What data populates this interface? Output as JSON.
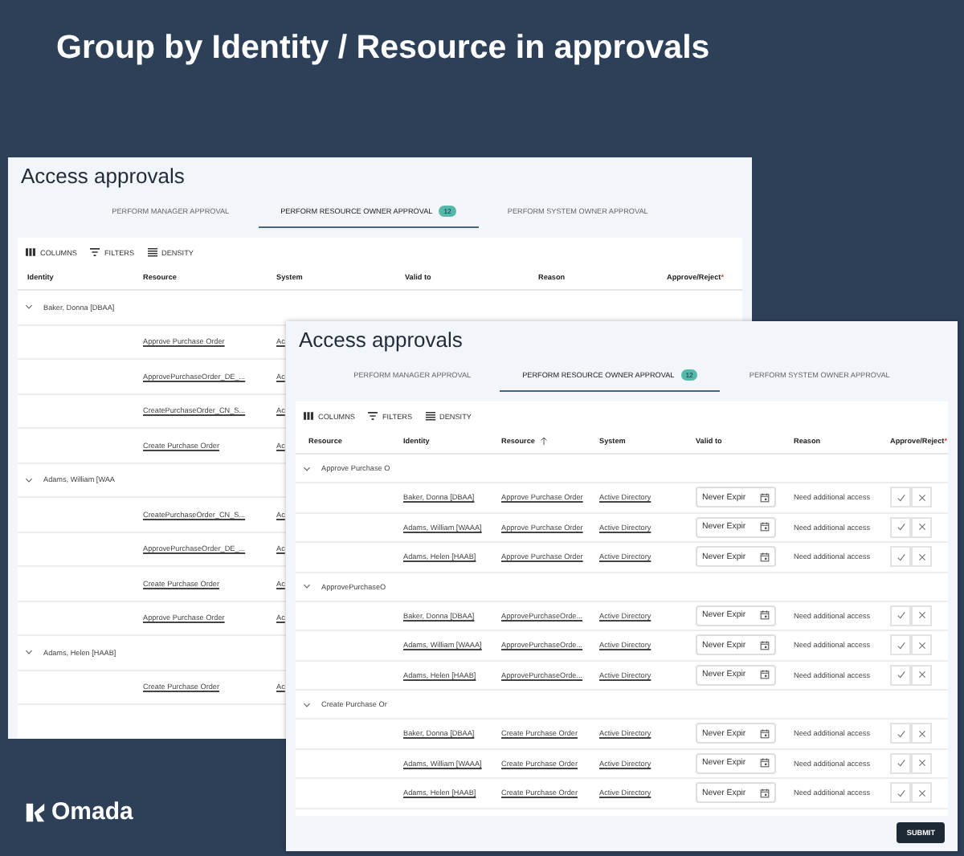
{
  "slide_title": "Group by Identity / Resource in approvals",
  "back_window": {
    "title": "Access approvals",
    "tabs": [
      {
        "label": "PERFORM MANAGER APPROVAL",
        "selected": false
      },
      {
        "label": "PERFORM RESOURCE OWNER APPROVAL",
        "selected": true,
        "badge": "12"
      },
      {
        "label": "PERFORM SYSTEM OWNER APPROVAL",
        "selected": false
      }
    ],
    "toolbar": [
      {
        "kind": "columns",
        "label": "COLUMNS"
      },
      {
        "kind": "filters",
        "label": "FILTERS"
      },
      {
        "kind": "density",
        "label": "DENSITY"
      }
    ],
    "columns": [
      {
        "label": "Identity"
      },
      {
        "label": "Resource"
      },
      {
        "label": "System"
      },
      {
        "label": "Valid to"
      },
      {
        "label": "Reason"
      },
      {
        "label": "Approve/Reject",
        "marker": "*"
      }
    ],
    "groups": [
      {
        "label": "Baker, Donna [DBAA]",
        "expanded": true,
        "rows": [
          {
            "resource": "Approve Purchase Order",
            "system": "Ac"
          },
          {
            "resource": "ApprovePurchaseOrder_DE_...",
            "system": "Ac"
          },
          {
            "resource": "CreatePurchaseOrder_CN_S...",
            "system": "Ac"
          },
          {
            "resource": "Create Purchase Order",
            "system": "Ac"
          }
        ]
      },
      {
        "label": "Adams, William [WAA",
        "expanded": true,
        "rows": [
          {
            "resource": "CreatePurchaseOrder_CN_S...",
            "system": "Ac"
          },
          {
            "resource": "ApprovePurchaseOrder_DE_...",
            "system": "Ac"
          },
          {
            "resource": "Create Purchase Order",
            "system": "Ac"
          },
          {
            "resource": "Approve Purchase Order",
            "system": "Ac"
          }
        ]
      },
      {
        "label": "Adams, Helen [HAAB]",
        "expanded": true,
        "rows": [
          {
            "resource": "Create Purchase Order",
            "system": "Ac"
          }
        ]
      }
    ]
  },
  "front_window": {
    "title": "Access approvals",
    "tabs": [
      {
        "label": "PERFORM MANAGER APPROVAL",
        "selected": false
      },
      {
        "label": "PERFORM RESOURCE OWNER APPROVAL",
        "selected": true,
        "badge": "12"
      },
      {
        "label": "PERFORM SYSTEM OWNER APPROVAL",
        "selected": false
      }
    ],
    "toolbar": [
      {
        "kind": "columns",
        "label": "COLUMNS"
      },
      {
        "kind": "filters",
        "label": "FILTERS"
      },
      {
        "kind": "density",
        "label": "DENSITY"
      }
    ],
    "columns": [
      {
        "label": "Resource"
      },
      {
        "label": "Identity"
      },
      {
        "label": "Resource",
        "sorted": true
      },
      {
        "label": "System"
      },
      {
        "label": "Valid to"
      },
      {
        "label": "Reason"
      },
      {
        "label": "Approve/Reject",
        "marker": "*"
      }
    ],
    "groups": [
      {
        "label": "Approve Purchase O",
        "expanded": true,
        "rows": [
          {
            "identity": "Baker, Donna [DBAA]",
            "resource": "Approve Purchase Order",
            "system": "Active Directory",
            "valid_to": "Never Expir",
            "reason": "Need additional access"
          },
          {
            "identity": "Adams, William [WAAA]",
            "resource": "Approve Purchase Order",
            "system": "Active Directory",
            "valid_to": "Never Expir",
            "reason": "Need additional access"
          },
          {
            "identity": "Adams, Helen [HAAB]",
            "resource": "Approve Purchase Order",
            "system": "Active Directory",
            "valid_to": "Never Expir",
            "reason": "Need additional access"
          }
        ]
      },
      {
        "label": "ApprovePurchaseO",
        "expanded": true,
        "rows": [
          {
            "identity": "Baker, Donna [DBAA]",
            "resource": "ApprovePurchaseOrde...",
            "system": "Active Directory",
            "valid_to": "Never Expir",
            "reason": "Need additional access"
          },
          {
            "identity": "Adams, William [WAAA]",
            "resource": "ApprovePurchaseOrde...",
            "system": "Active Directory",
            "valid_to": "Never Expir",
            "reason": "Need additional access"
          },
          {
            "identity": "Adams, Helen [HAAB]",
            "resource": "ApprovePurchaseOrde...",
            "system": "Active Directory",
            "valid_to": "Never Expir",
            "reason": "Need additional access"
          }
        ]
      },
      {
        "label": "Create Purchase Or",
        "expanded": true,
        "rows": [
          {
            "identity": "Baker, Donna [DBAA]",
            "resource": "Create Purchase Order",
            "system": "Active Directory",
            "valid_to": "Never Expir",
            "reason": "Need additional access"
          },
          {
            "identity": "Adams, William [WAAA]",
            "resource": "Create Purchase Order",
            "system": "Active Directory",
            "valid_to": "Never Expir",
            "reason": "Need additional access"
          },
          {
            "identity": "Adams, Helen [HAAB]",
            "resource": "Create Purchase Order",
            "system": "Active Directory",
            "valid_to": "Never Expir",
            "reason": "Need additional access"
          }
        ]
      }
    ],
    "submit": "SUBMIT"
  },
  "logo": "Omada"
}
